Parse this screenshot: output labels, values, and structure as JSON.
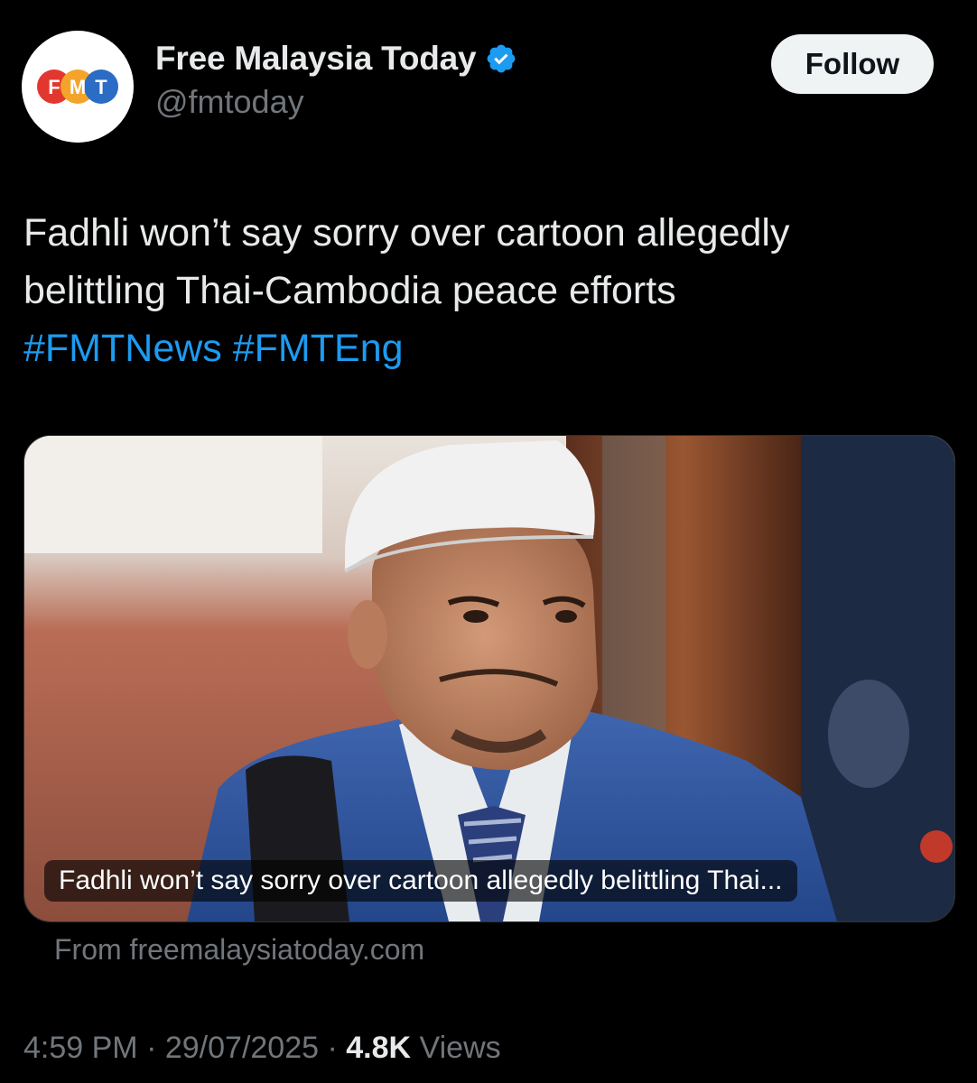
{
  "account": {
    "logo_letters": [
      "F",
      "M",
      "T"
    ],
    "display_name": "Free Malaysia Today",
    "handle": "@fmtoday",
    "verified": true
  },
  "actions": {
    "follow_label": "Follow"
  },
  "tweet": {
    "text_line1": "Fadhli won’t say sorry over cartoon allegedly",
    "text_line2": "belittling Thai-Cambodia peace efforts",
    "hashtags": [
      "#FMTNews",
      "#FMTEng"
    ]
  },
  "card": {
    "caption": "Fadhli won’t say sorry over cartoon allegedly belittling Thai...",
    "source": "From freemalaysiatoday.com"
  },
  "meta": {
    "time": "4:59 PM",
    "separator": "·",
    "date": "29/07/2025",
    "views_count": "4.8K",
    "views_label": "Views"
  },
  "colors": {
    "background": "#000000",
    "hashtag": "#1d9bf0",
    "verified": "#1d9bf0",
    "logo_red": "#e2372f",
    "logo_orange": "#f4a42a",
    "logo_blue": "#2b6cc4"
  }
}
